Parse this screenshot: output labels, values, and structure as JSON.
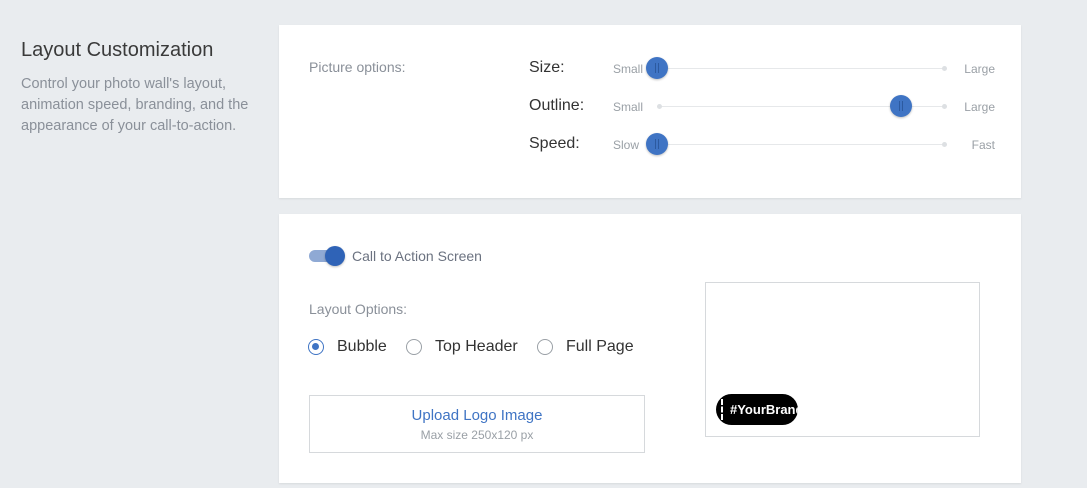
{
  "intro": {
    "title": "Layout Customization",
    "description": "Control your photo wall's layout, animation speed, branding, and the appearance of your call-to-action."
  },
  "picture_options": {
    "label": "Picture options:",
    "sliders": [
      {
        "name": "Size:",
        "min_label": "Small",
        "max_label": "Large",
        "value_fraction": 0
      },
      {
        "name": "Outline:",
        "min_label": "Small",
        "max_label": "Large",
        "value_fraction": 0.84
      },
      {
        "name": "Speed:",
        "min_label": "Slow",
        "max_label": "Fast",
        "value_fraction": 0
      }
    ]
  },
  "cta": {
    "toggle_label": "Call to Action Screen",
    "toggle_on": true,
    "layout_label": "Layout Options:",
    "options": [
      {
        "label": "Bubble",
        "checked": true
      },
      {
        "label": "Top Header",
        "checked": false
      },
      {
        "label": "Full Page",
        "checked": false
      }
    ],
    "upload": {
      "title": "Upload Logo Image",
      "subtitle": "Max size 250x120 px"
    },
    "preview": {
      "bubble_text": "#YourBrand"
    }
  },
  "colors": {
    "accent": "#3f74c4",
    "background": "#e9ecef",
    "bubble": "#000000"
  }
}
